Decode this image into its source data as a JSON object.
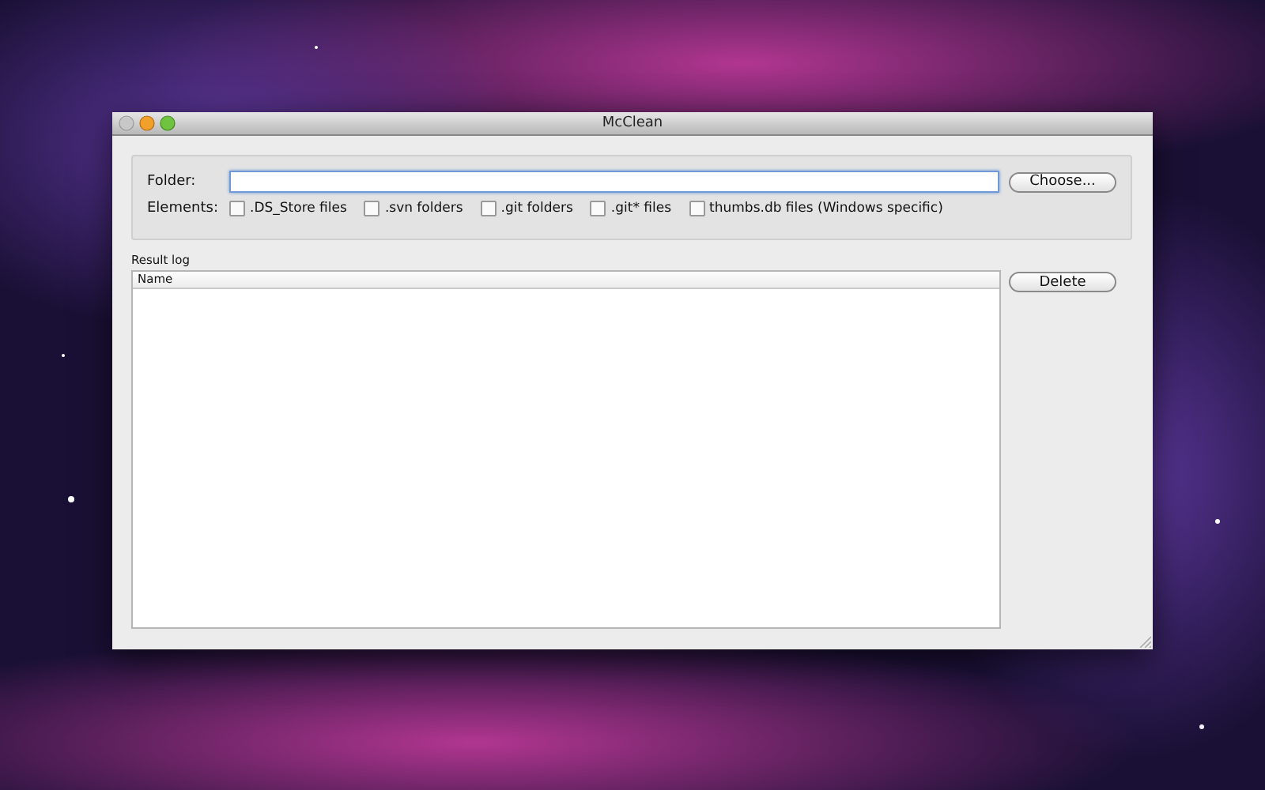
{
  "window": {
    "title": "McClean"
  },
  "folder": {
    "label": "Folder:"
  },
  "choose_button": "Choose...",
  "elements": {
    "label": "Elements:",
    "options": [
      {
        "label": ".DS_Store files",
        "checked": false
      },
      {
        "label": ".svn folders",
        "checked": false
      },
      {
        "label": ".git folders",
        "checked": false
      },
      {
        "label": ".git* files",
        "checked": false
      },
      {
        "label": "thumbs.db files (Windows specific)",
        "checked": false
      }
    ]
  },
  "result_log": {
    "label": "Result log",
    "columns": [
      "Name"
    ]
  },
  "delete_button": "Delete"
}
